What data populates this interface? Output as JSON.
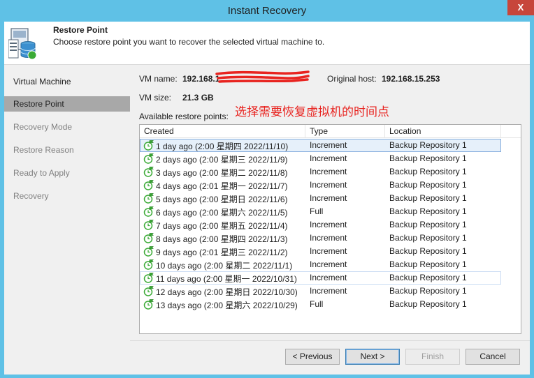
{
  "window": {
    "title": "Instant Recovery",
    "close_label": "X"
  },
  "header": {
    "title": "Restore Point",
    "subtitle": "Choose restore point you want to recover the selected virtual machine to."
  },
  "steps": [
    {
      "label": "Virtual Machine",
      "state": "done"
    },
    {
      "label": "Restore Point",
      "state": "active"
    },
    {
      "label": "Recovery Mode",
      "state": "pending"
    },
    {
      "label": "Restore Reason",
      "state": "pending"
    },
    {
      "label": "Ready to Apply",
      "state": "pending"
    },
    {
      "label": "Recovery",
      "state": "pending"
    }
  ],
  "vm": {
    "name_label": "VM name:",
    "name_value": "192.168.1",
    "original_host_label": "Original host:",
    "original_host_value": "192.168.15.253",
    "size_label": "VM size:",
    "size_value": "21.3 GB",
    "available_label": "Available restore points:"
  },
  "annotation": "选择需要恢复虚拟机的时间点",
  "table": {
    "columns": [
      "Created",
      "Type",
      "Location"
    ],
    "rows": [
      {
        "created": "1 day ago (2:00 星期四 2022/11/10)",
        "type": "Increment",
        "location": "Backup Repository 1"
      },
      {
        "created": "2 days ago (2:00 星期三 2022/11/9)",
        "type": "Increment",
        "location": "Backup Repository 1"
      },
      {
        "created": "3 days ago (2:00 星期二 2022/11/8)",
        "type": "Increment",
        "location": "Backup Repository 1"
      },
      {
        "created": "4 days ago (2:01 星期一 2022/11/7)",
        "type": "Increment",
        "location": "Backup Repository 1"
      },
      {
        "created": "5 days ago (2:00 星期日 2022/11/6)",
        "type": "Increment",
        "location": "Backup Repository 1"
      },
      {
        "created": "6 days ago (2:00 星期六 2022/11/5)",
        "type": "Full",
        "location": "Backup Repository 1"
      },
      {
        "created": "7 days ago (2:00 星期五 2022/11/4)",
        "type": "Increment",
        "location": "Backup Repository 1"
      },
      {
        "created": "8 days ago (2:00 星期四 2022/11/3)",
        "type": "Increment",
        "location": "Backup Repository 1"
      },
      {
        "created": "9 days ago (2:01 星期三 2022/11/2)",
        "type": "Increment",
        "location": "Backup Repository 1"
      },
      {
        "created": "10 days ago (2:00 星期二 2022/11/1)",
        "type": "Increment",
        "location": "Backup Repository 1"
      },
      {
        "created": "11 days ago (2:00 星期一 2022/10/31)",
        "type": "Increment",
        "location": "Backup Repository 1"
      },
      {
        "created": "12 days ago (2:00 星期日 2022/10/30)",
        "type": "Increment",
        "location": "Backup Repository 1"
      },
      {
        "created": "13 days ago (2:00 星期六 2022/10/29)",
        "type": "Full",
        "location": "Backup Repository 1"
      }
    ]
  },
  "buttons": {
    "previous": "< Previous",
    "next": "Next >",
    "finish": "Finish",
    "cancel": "Cancel"
  },
  "colors": {
    "annotation": "#e8231f",
    "selected_row": "#e6f0fa",
    "titlebar": "#5fc1e6"
  }
}
